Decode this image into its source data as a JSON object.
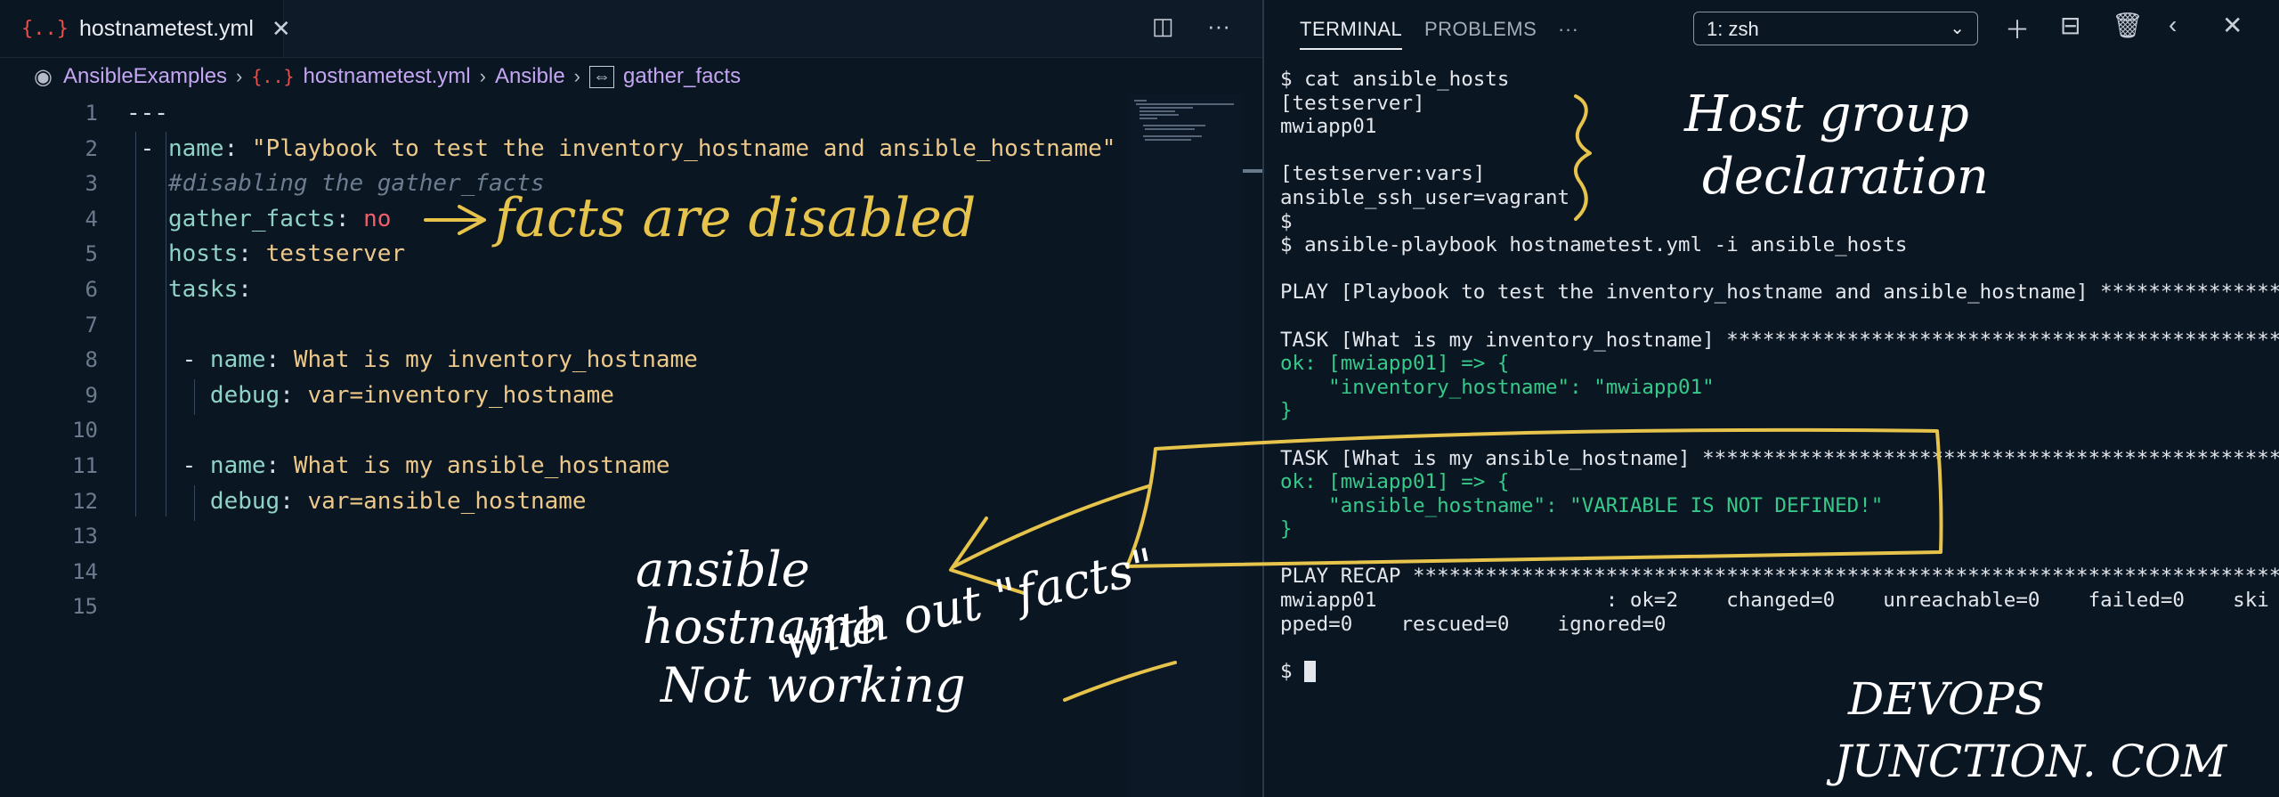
{
  "editor": {
    "tab": {
      "icon": "{..}",
      "filename": "hostnametest.yml"
    },
    "breadcrumb": [
      {
        "label": "AnsibleExamples"
      },
      {
        "label": "hostnametest.yml"
      },
      {
        "label": "Ansible"
      },
      {
        "label": "gather_facts"
      }
    ],
    "line_numbers": [
      "1",
      "2",
      "3",
      "4",
      "5",
      "6",
      "7",
      "8",
      "9",
      "10",
      "11",
      "12",
      "13",
      "14",
      "15"
    ],
    "code": {
      "l1": "---",
      "l2_dash": "- ",
      "l2_key": "name",
      "l2_val": "\"Playbook to test the inventory_hostname and ansible_hostname\"",
      "l3": "#disabling the gather_facts",
      "l4_key": "gather_facts",
      "l4_val": "no",
      "l5_key": "hosts",
      "l5_val": "testserver",
      "l6_key": "tasks",
      "l8_key": "name",
      "l8_val": "What is my inventory_hostname",
      "l9_key": "debug",
      "l9_val": "var=inventory_hostname",
      "l11_key": "name",
      "l11_val": "What is my ansible_hostname",
      "l12_key": "debug",
      "l12_val": "var=ansible_hostname"
    }
  },
  "terminal": {
    "tabs": [
      "TERMINAL",
      "PROBLEMS",
      "···"
    ],
    "shell_select": "1: zsh",
    "lines": [
      "$ cat ansible_hosts",
      "[testserver]",
      "mwiapp01",
      "",
      "[testserver:vars]",
      "ansible_ssh_user=vagrant",
      "$",
      "$ ansible-playbook hostnametest.yml -i ansible_hosts",
      "",
      "PLAY [Playbook to test the inventory_hostname and ansible_hostname] ******************",
      "",
      "TASK [What is my inventory_hostname] ********************************************************",
      "ok: [mwiapp01] => {",
      "    \"inventory_hostname\": \"mwiapp01\"",
      "}",
      "",
      "TASK [What is my ansible_hostname] **********************************************************",
      "ok: [mwiapp01] => {",
      "    \"ansible_hostname\": \"VARIABLE IS NOT DEFINED!\"",
      "}",
      "",
      "PLAY RECAP *************************************************************************************",
      "mwiapp01                   : ok=2    changed=0    unreachable=0    failed=0    ski",
      "pped=0    rescued=0    ignored=0",
      "",
      "$ "
    ]
  },
  "annotations": {
    "facts_disabled": "facts are disabled",
    "host_group_1": "Host group",
    "host_group_2": "declaration",
    "note_1": "ansible",
    "note_2": "hostname",
    "note_3": "Not working",
    "note_4": "with out \"facts\"",
    "brand_1": "DEVOPS",
    "brand_2": "JUNCTION. COM"
  },
  "colors": {
    "background": "#0b1623",
    "terminal_green": "#37c98a",
    "annotation_yellow": "#e6c34a"
  }
}
